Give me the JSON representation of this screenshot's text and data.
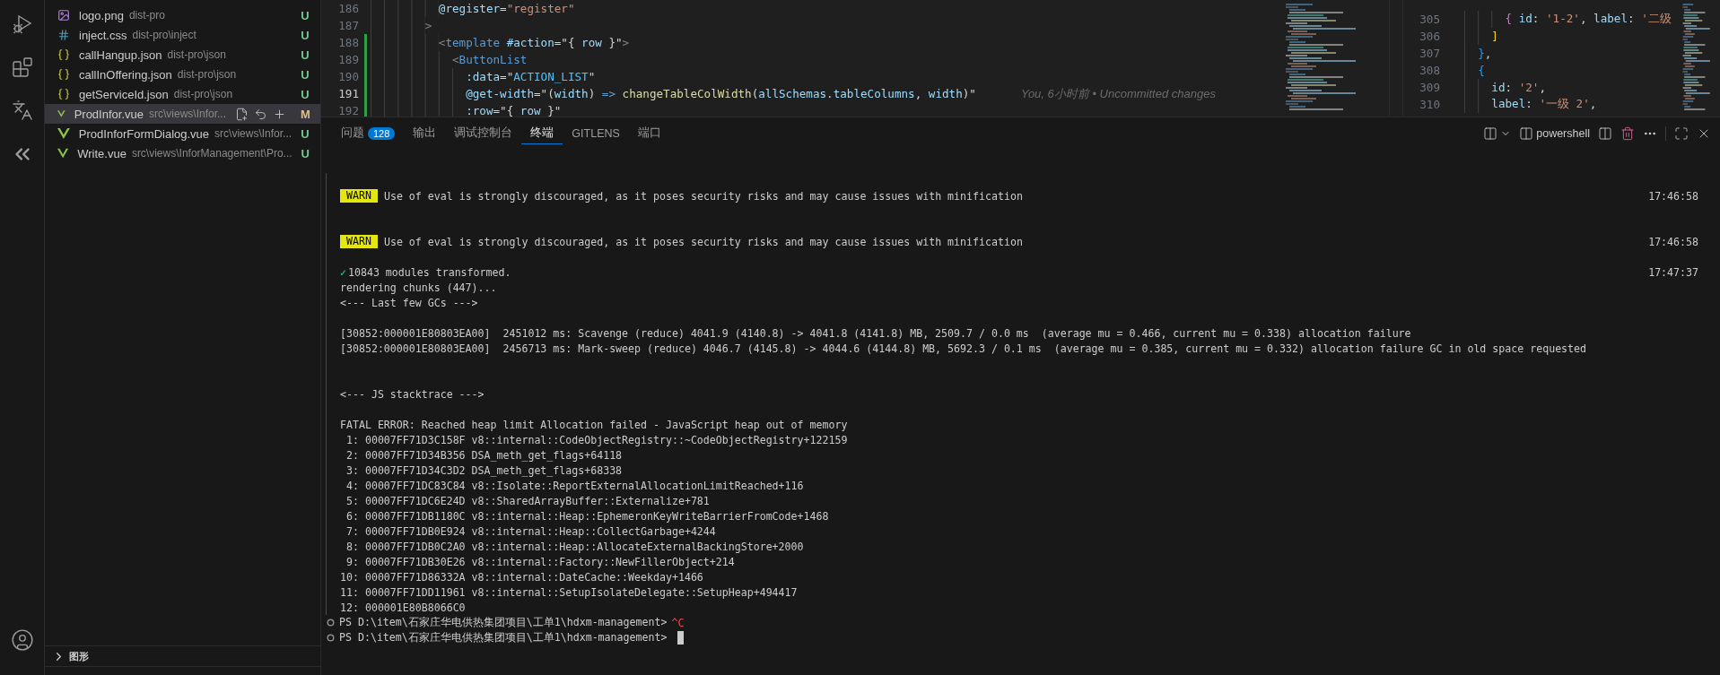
{
  "explorer": {
    "files": [
      {
        "kind": "image",
        "name": "logo.png",
        "path": "dist-pro",
        "status": "U",
        "color": "#73c991",
        "selected": false
      },
      {
        "kind": "css",
        "name": "inject.css",
        "path": "dist-pro\\inject",
        "status": "U",
        "color": "#73c991",
        "selected": false
      },
      {
        "kind": "json",
        "name": "callHangup.json",
        "path": "dist-pro\\json",
        "status": "U",
        "color": "#73c991",
        "selected": false
      },
      {
        "kind": "json",
        "name": "callInOffering.json",
        "path": "dist-pro\\json",
        "status": "U",
        "color": "#73c991",
        "selected": false
      },
      {
        "kind": "json",
        "name": "getServiceId.json",
        "path": "dist-pro\\json",
        "status": "U",
        "color": "#73c991",
        "selected": false
      },
      {
        "kind": "vue",
        "name": "ProdInfor.vue",
        "path": "src\\views\\Infor...",
        "status": "M",
        "color": "#e2c08d",
        "selected": true
      },
      {
        "kind": "vue",
        "name": "ProdInforFormDialog.vue",
        "path": "src\\views\\Infor...",
        "status": "U",
        "color": "#73c991",
        "selected": false
      },
      {
        "kind": "vue",
        "name": "Write.vue",
        "path": "src\\views\\InforManagement\\Pro...",
        "status": "U",
        "color": "#73c991",
        "selected": false
      }
    ],
    "sections": [
      {
        "title": "图形",
        "expanded": false
      }
    ]
  },
  "editor_left": {
    "lines": [
      {
        "number": "186",
        "active": false,
        "modified": false,
        "tokens": [
          {
            "kind": "attr",
            "text": "          @register"
          },
          {
            "kind": "plain",
            "text": "="
          },
          {
            "kind": "string",
            "text": "\"register\""
          }
        ]
      },
      {
        "number": "187",
        "active": false,
        "modified": false,
        "tokens": [
          {
            "kind": "punct",
            "text": "        >"
          }
        ]
      },
      {
        "number": "188",
        "active": false,
        "modified": true,
        "tokens": [
          {
            "kind": "punct",
            "text": "          <"
          },
          {
            "kind": "tag",
            "text": "template"
          },
          {
            "kind": "attr",
            "text": " #action"
          },
          {
            "kind": "plain",
            "text": "=\"{ "
          },
          {
            "kind": "var",
            "text": "row"
          },
          {
            "kind": "plain",
            "text": " }\""
          },
          {
            "kind": "punct",
            "text": ">"
          }
        ]
      },
      {
        "number": "189",
        "active": false,
        "modified": true,
        "tokens": [
          {
            "kind": "punct",
            "text": "            <"
          },
          {
            "kind": "tag",
            "text": "ButtonList"
          }
        ]
      },
      {
        "number": "190",
        "active": false,
        "modified": true,
        "tokens": [
          {
            "kind": "attr",
            "text": "              :data"
          },
          {
            "kind": "plain",
            "text": "=\""
          },
          {
            "kind": "const",
            "text": "ACTION_LIST"
          },
          {
            "kind": "plain",
            "text": "\""
          }
        ]
      },
      {
        "number": "191",
        "active": true,
        "modified": true,
        "blame": "You, 6小时前 • Uncommitted changes",
        "tokens": [
          {
            "kind": "attr",
            "text": "              @get-width"
          },
          {
            "kind": "plain",
            "text": "=\"("
          },
          {
            "kind": "var",
            "text": "width"
          },
          {
            "kind": "plain",
            "text": ") "
          },
          {
            "kind": "tag",
            "text": "=>"
          },
          {
            "kind": "func",
            "text": " changeTableColWidth"
          },
          {
            "kind": "plain",
            "text": "("
          },
          {
            "kind": "var",
            "text": "allSchemas"
          },
          {
            "kind": "plain",
            "text": "."
          },
          {
            "kind": "var",
            "text": "tableColumns"
          },
          {
            "kind": "plain",
            "text": ", "
          },
          {
            "kind": "var",
            "text": "width"
          },
          {
            "kind": "plain",
            "text": ")\""
          }
        ]
      },
      {
        "number": "192",
        "active": false,
        "modified": true,
        "tokens": [
          {
            "kind": "attr",
            "text": "              :row"
          },
          {
            "kind": "plain",
            "text": "=\"{ "
          },
          {
            "kind": "var",
            "text": "row"
          },
          {
            "kind": "plain",
            "text": " }\""
          }
        ]
      }
    ]
  },
  "editor_right": {
    "lines": [
      {
        "number": "305",
        "tokens": [
          {
            "kind": "brace1",
            "text": "      {"
          },
          {
            "kind": "var",
            "text": " id"
          },
          {
            "kind": "plain",
            "text": ": "
          },
          {
            "kind": "string",
            "text": "'1-2'"
          },
          {
            "kind": "plain",
            "text": ", "
          },
          {
            "kind": "var",
            "text": "label"
          },
          {
            "kind": "plain",
            "text": ": "
          },
          {
            "kind": "string",
            "text": "'二级"
          }
        ]
      },
      {
        "number": "306",
        "tokens": [
          {
            "kind": "bracket",
            "text": "    ]"
          }
        ]
      },
      {
        "number": "307",
        "tokens": [
          {
            "kind": "brace3",
            "text": "  }"
          },
          {
            "kind": "plain",
            "text": ","
          }
        ]
      },
      {
        "number": "308",
        "tokens": [
          {
            "kind": "brace3",
            "text": "  {"
          }
        ]
      },
      {
        "number": "309",
        "tokens": [
          {
            "kind": "var",
            "text": "    id"
          },
          {
            "kind": "plain",
            "text": ": "
          },
          {
            "kind": "string",
            "text": "'2'"
          },
          {
            "kind": "plain",
            "text": ","
          }
        ]
      },
      {
        "number": "310",
        "tokens": [
          {
            "kind": "var",
            "text": "    label"
          },
          {
            "kind": "plain",
            "text": ": "
          },
          {
            "kind": "string",
            "text": "'一级 2'"
          },
          {
            "kind": "plain",
            "text": ","
          }
        ]
      }
    ]
  },
  "panel": {
    "tabs": [
      {
        "label": "问题",
        "badge": "128",
        "selected": false
      },
      {
        "label": "输出",
        "selected": false
      },
      {
        "label": "调试控制台",
        "selected": false
      },
      {
        "label": "终端",
        "selected": true
      },
      {
        "label": "GITLENS",
        "selected": false
      },
      {
        "label": "端口",
        "selected": false
      }
    ],
    "shell": "powershell"
  },
  "terminal": {
    "blocks": [
      {
        "kind": "warn",
        "lines": [
          {
            "kind": "warn",
            "badge": "WARN",
            "text": "Use of eval is strongly discouraged, as it poses security risks and may cause issues with minification",
            "time": "17:46:58"
          }
        ]
      },
      {
        "kind": "warn",
        "lines": [
          {
            "kind": "warn",
            "badge": "WARN",
            "text": "Use of eval is strongly discouraged, as it poses security risks and may cause issues with minification",
            "time": "17:46:58"
          }
        ]
      },
      {
        "kind": "log",
        "lines": [
          {
            "kind": "success",
            "mark": "✓",
            "text": "10843 modules transformed.",
            "time": "17:47:37"
          },
          {
            "kind": "text",
            "text": "rendering chunks (447)..."
          },
          {
            "kind": "text",
            "text": "<--- Last few GCs --->"
          }
        ]
      },
      {
        "kind": "log",
        "lines": [
          {
            "kind": "text",
            "text": "[30852:000001E80803EA00]  2451012 ms: Scavenge (reduce) 4041.9 (4140.8) -> 4041.8 (4141.8) MB, 2509.7 / 0.0 ms  (average mu = 0.466, current mu = 0.338) allocation failure"
          },
          {
            "kind": "text",
            "text": "[30852:000001E80803EA00]  2456713 ms: Mark-sweep (reduce) 4046.7 (4145.8) -> 4044.6 (4144.8) MB, 5692.3 / 0.1 ms  (average mu = 0.385, current mu = 0.332) allocation failure GC in old space requested"
          }
        ]
      },
      {
        "kind": "section",
        "lines": [
          {
            "kind": "text",
            "text": "<--- JS stacktrace --->"
          }
        ]
      },
      {
        "kind": "log",
        "lines": [
          {
            "kind": "text",
            "text": "FATAL ERROR: Reached heap limit Allocation failed - JavaScript heap out of memory"
          },
          {
            "kind": "text",
            "text": " 1: 00007FF71D3C158F v8::internal::CodeObjectRegistry::~CodeObjectRegistry+122159"
          },
          {
            "kind": "text",
            "text": " 2: 00007FF71D34B356 DSA_meth_get_flags+64118"
          },
          {
            "kind": "text",
            "text": " 3: 00007FF71D34C3D2 DSA_meth_get_flags+68338"
          },
          {
            "kind": "text",
            "text": " 4: 00007FF71DC83C84 v8::Isolate::ReportExternalAllocationLimitReached+116"
          },
          {
            "kind": "text",
            "text": " 5: 00007FF71DC6E24D v8::SharedArrayBuffer::Externalize+781"
          },
          {
            "kind": "text",
            "text": " 6: 00007FF71DB1180C v8::internal::Heap::EphemeronKeyWriteBarrierFromCode+1468"
          },
          {
            "kind": "text",
            "text": " 7: 00007FF71DB0E924 v8::internal::Heap::CollectGarbage+4244"
          },
          {
            "kind": "text",
            "text": " 8: 00007FF71DB0C2A0 v8::internal::Heap::AllocateExternalBackingStore+2000"
          },
          {
            "kind": "text",
            "text": " 9: 00007FF71DB30E26 v8::internal::Factory::NewFillerObject+214"
          },
          {
            "kind": "text",
            "text": "10: 00007FF71D86332A v8::internal::DateCache::Weekday+1466"
          },
          {
            "kind": "text",
            "text": "11: 00007FF71DD11961 v8::internal::SetupIsolateDelegate::SetupHeap+494417"
          },
          {
            "kind": "text",
            "text": "12: 000001E80B8066C0"
          }
        ]
      }
    ],
    "prompts": [
      {
        "text": "PS D:\\item\\石家庄华电供热集团项目\\工单1\\hdxm-management>",
        "input": "^C",
        "cursor": false
      },
      {
        "text": "PS D:\\item\\石家庄华电供热集团项目\\工单1\\hdxm-management>",
        "cursor": true
      }
    ]
  }
}
